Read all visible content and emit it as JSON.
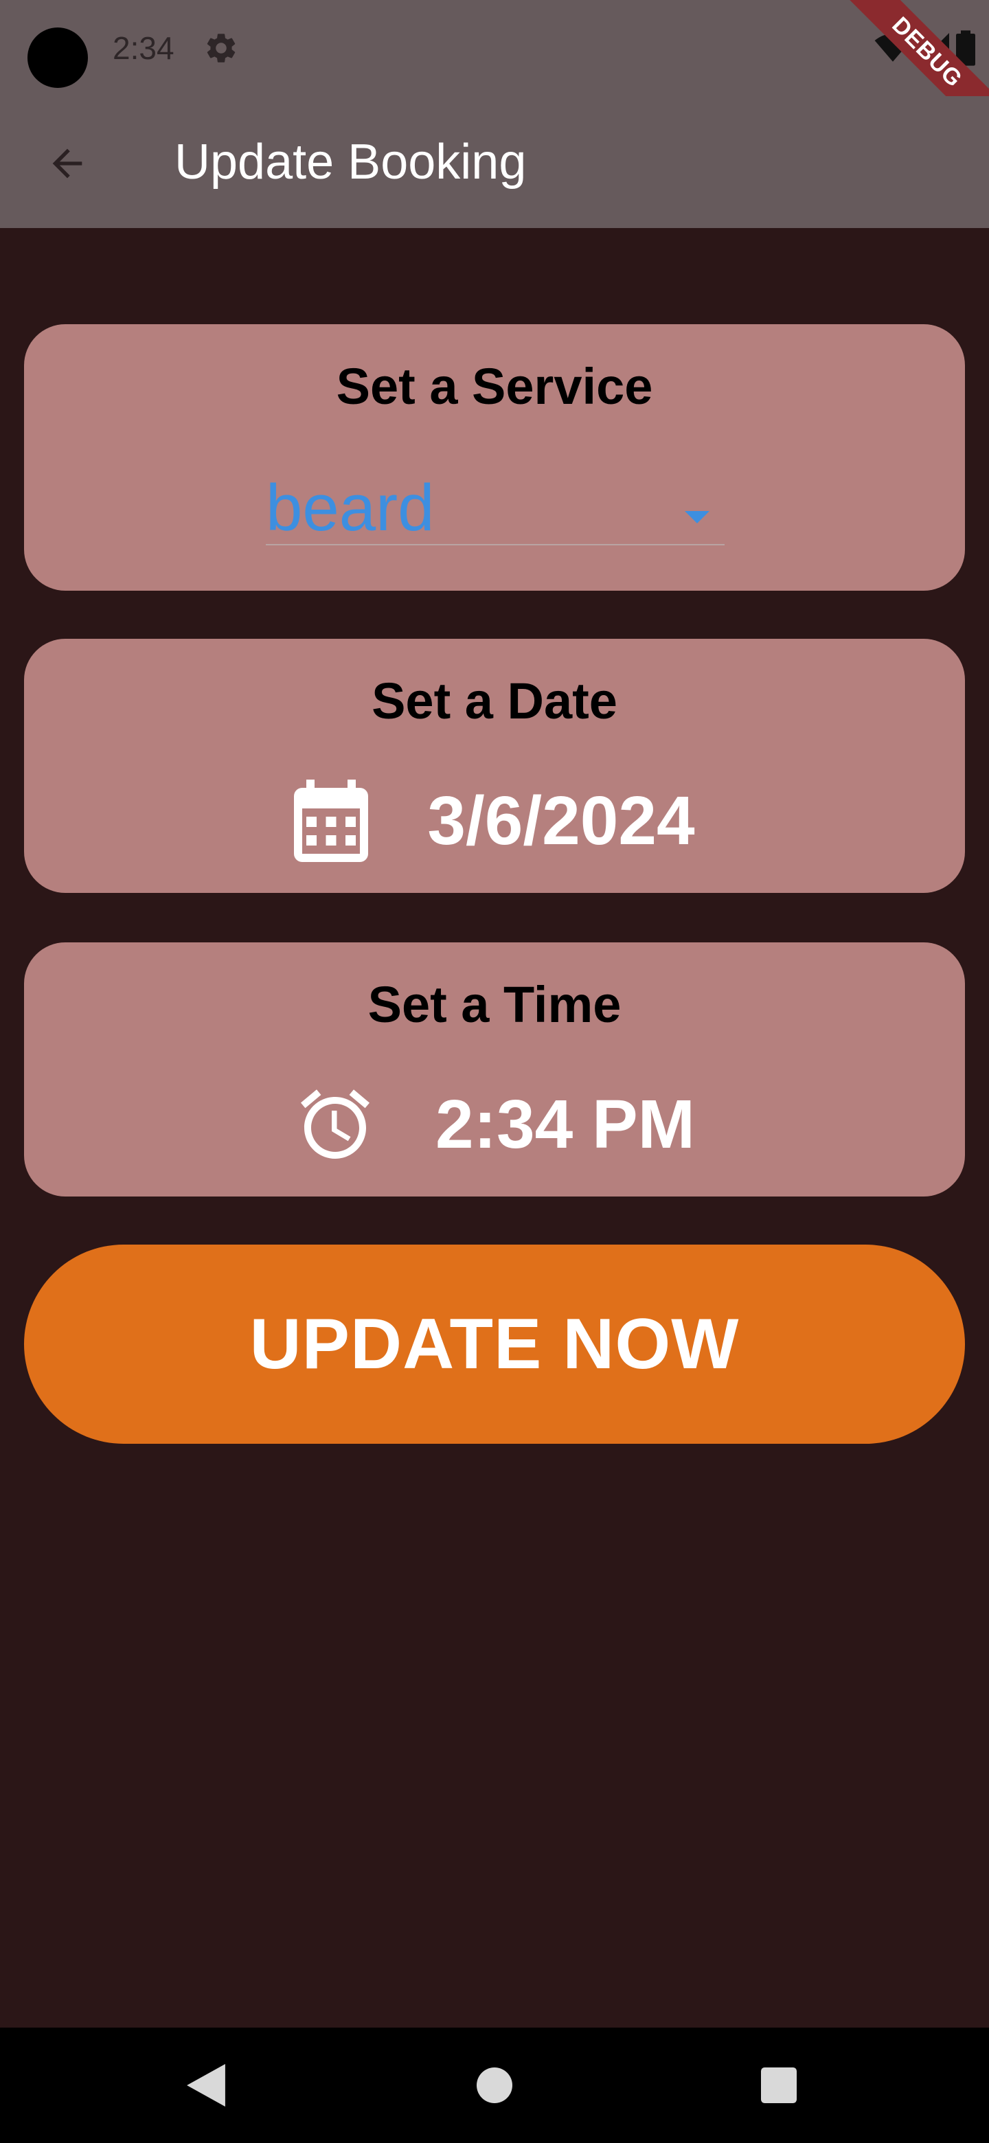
{
  "status_bar": {
    "time": "2:34",
    "icons": [
      "settings-icon",
      "wifi-icon",
      "signal-icon",
      "battery-icon"
    ]
  },
  "debug_banner": {
    "label": "DEBUG",
    "color": "#8b2a2e"
  },
  "app_bar": {
    "title": "Update Booking",
    "back_icon": "arrow-back-icon"
  },
  "service_card": {
    "title": "Set a Service",
    "selected_service": "beard",
    "dropdown_icon": "arrow-drop-down-icon"
  },
  "date_card": {
    "title": "Set a Date",
    "icon": "calendar-icon",
    "value": "3/6/2024"
  },
  "time_card": {
    "title": "Set a Time",
    "icon": "alarm-clock-icon",
    "value": "2:34 PM"
  },
  "update_button": {
    "label": "UPDATE NOW"
  },
  "nav_bar": {
    "buttons": [
      "back-triangle-icon",
      "home-circle-icon",
      "recents-square-icon"
    ]
  },
  "colors": {
    "background": "#2b1617",
    "app_bar": "#665a5c",
    "card": "#b5807e",
    "accent_blue": "#3d8fe0",
    "button": "#e0701a"
  }
}
